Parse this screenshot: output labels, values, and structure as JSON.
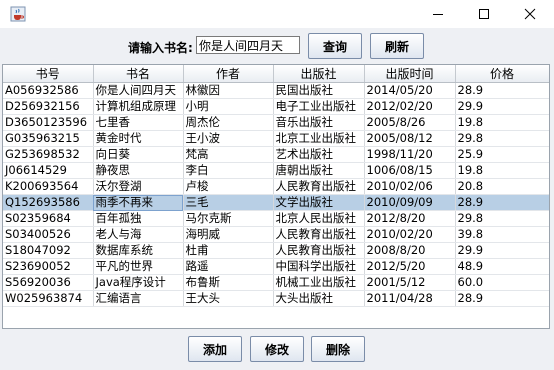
{
  "window": {
    "title": ""
  },
  "search": {
    "label": "请输入书名:",
    "value": "你是人间四月天",
    "search_button": "查询",
    "refresh_button": "刷新"
  },
  "table": {
    "columns": [
      "书号",
      "书名",
      "作者",
      "出版社",
      "出版时间",
      "价格"
    ],
    "rows": [
      [
        "A056932586",
        "你是人间四月天",
        "林徽因",
        "民国出版社",
        "2014/05/20",
        "28.9"
      ],
      [
        "D256932156",
        "计算机组成原理",
        "小明",
        "电子工业出版社",
        "2012/02/20",
        "29.9"
      ],
      [
        "D3650123596",
        "七里香",
        "周杰伦",
        "音乐出版社",
        "2005/8/26",
        "19.8"
      ],
      [
        "G035963215",
        "黄金时代",
        "王小波",
        "北京工业出版社",
        "2005/08/12",
        "29.8"
      ],
      [
        "G253698532",
        "向日葵",
        "梵高",
        "艺术出版社",
        "1998/11/20",
        "25.9"
      ],
      [
        "J06614529",
        "静夜思",
        "李白",
        "唐朝出版社",
        "1006/08/15",
        "19.8"
      ],
      [
        "K200693564",
        "沃尔登湖",
        "卢梭",
        "人民教育出版社",
        "2010/02/06",
        "20.8"
      ],
      [
        "Q152693586",
        "雨季不再来",
        "三毛",
        "文学出版社",
        "2010/09/09",
        "28.9"
      ],
      [
        "S02359684",
        "百年孤独",
        "马尔克斯",
        "北京人民出版社",
        "2012/8/20",
        "29.8"
      ],
      [
        "S03400526",
        "老人与海",
        "海明威",
        "人民教育出版社",
        "2010/02/20",
        "39.8"
      ],
      [
        "S18047092",
        "数据库系统",
        "杜甫",
        "人民教育出版社",
        "2008/8/20",
        "29.9"
      ],
      [
        "S23690052",
        "平凡的世界",
        "路遥",
        "中国科学出版社",
        "2012/5/20",
        "48.9"
      ],
      [
        "S56920036",
        "Java程序设计",
        "布鲁斯",
        "机械工业出版社",
        "2001/5/12",
        "60.0"
      ],
      [
        "W025963874",
        "汇编语言",
        "王大头",
        "大头出版社",
        "2011/04/28",
        "28.9"
      ]
    ],
    "selected_row": 7
  },
  "actions": {
    "add": "添加",
    "edit": "修改",
    "delete": "删除"
  },
  "icons": {
    "app": "java-cup-icon",
    "minimize": "minimize-icon",
    "maximize": "maximize-icon",
    "close": "close-icon"
  }
}
